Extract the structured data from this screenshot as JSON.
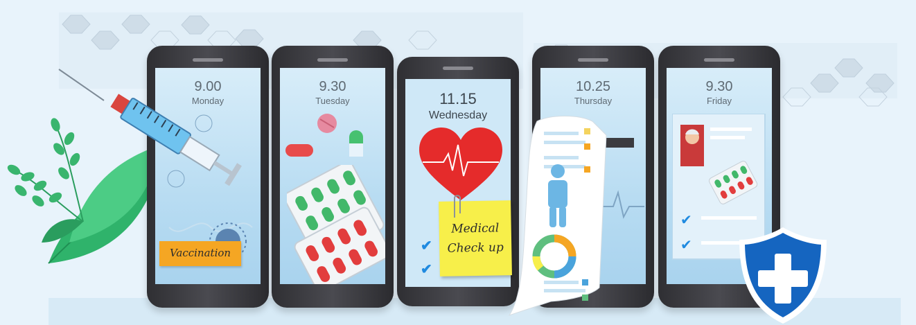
{
  "phones": [
    {
      "time": "9.00",
      "day": "Monday"
    },
    {
      "time": "9.30",
      "day": "Tuesday"
    },
    {
      "time": "11.15",
      "day": "Wednesday"
    },
    {
      "time": "10.25",
      "day": "Thursday"
    },
    {
      "time": "9.30",
      "day": "Friday"
    }
  ],
  "notes": {
    "vaccination": "Vaccination",
    "checkup_line1": "Medical",
    "checkup_line2": "Check up"
  },
  "colors": {
    "background": "#e8f3fb",
    "screen": "#b8dcf2",
    "heart": "#e52b2b",
    "shield": "#1565c0",
    "note_orange": "#f5a623",
    "note_yellow": "#f7ef4a",
    "leaf_green": "#2fb36b"
  },
  "icons": [
    "syringe-icon",
    "virus-icon",
    "pill-icon",
    "blister-pack-icon",
    "heart-ecg-icon",
    "checkmark-icon",
    "medical-report-icon",
    "body-figure-icon",
    "donut-chart-icon",
    "patient-avatar-icon",
    "shield-plus-icon",
    "leaf-icon"
  ]
}
